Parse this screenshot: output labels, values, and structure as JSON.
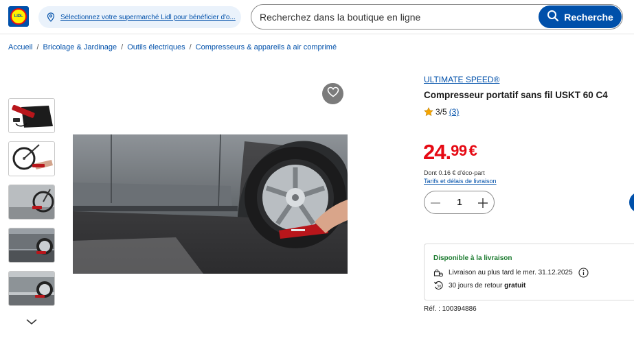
{
  "header": {
    "logo_text": "LIDL",
    "store_selector_label": "Sélectionnez votre supermarché Lidl pour bénéficier d'o...",
    "search_placeholder": "Recherchez dans la boutique en ligne",
    "search_button_label": "Recherche"
  },
  "breadcrumb": [
    {
      "label": "Accueil"
    },
    {
      "label": "Bricolage & Jardinage"
    },
    {
      "label": "Outils électriques"
    },
    {
      "label": "Compresseurs & appareils à air comprimé"
    }
  ],
  "breadcrumb_separator": "/",
  "product": {
    "brand": "ULTIMATE SPEED®",
    "title": "Compresseur portatif sans fil USKT 60 C4",
    "rating": {
      "score": "3/5",
      "count": "(3)"
    },
    "price": {
      "integer": "24.",
      "decimal": "99",
      "currency": "€"
    },
    "eco_part": "Dont 0.16 € d'éco-part",
    "shipping_link": "Tarifs et délais de livraison",
    "quantity": "1",
    "availability": {
      "title": "Disponible à la livraison",
      "delivery_text": "Livraison au plus tard le mer. 31.12.2025",
      "returns_text": "30 jours de retour",
      "returns_bold": "gratuit"
    },
    "reference": "Réf. : 100394886"
  },
  "colors": {
    "brand_blue": "#0050aa",
    "price_red": "#e60a14",
    "available_green": "#1a7a2e",
    "star": "#f5a400"
  },
  "icons": [
    "location-pin-icon",
    "search-icon",
    "heart-icon",
    "star-icon",
    "minus-icon",
    "plus-icon",
    "chevron-down-icon",
    "delivery-icon",
    "return-icon",
    "info-icon"
  ]
}
